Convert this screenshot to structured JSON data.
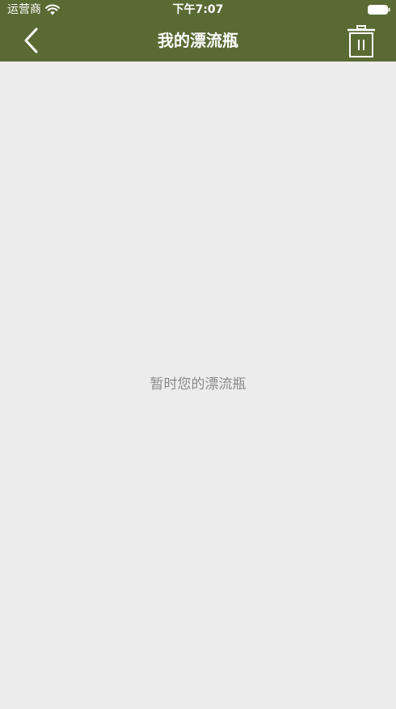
{
  "status_bar": {
    "carrier": "运营商",
    "time": "下午7:07",
    "wifi_icon": "wifi-icon",
    "battery_icon": "battery-full-icon"
  },
  "nav": {
    "title": "我的漂流瓶",
    "back_icon": "chevron-left-icon",
    "trash_icon": "trash-icon"
  },
  "content": {
    "empty_message": "暂时您的漂流瓶"
  },
  "colors": {
    "header_bg": "#596a33",
    "page_bg": "#ececec",
    "empty_text": "#8a8a8a"
  }
}
